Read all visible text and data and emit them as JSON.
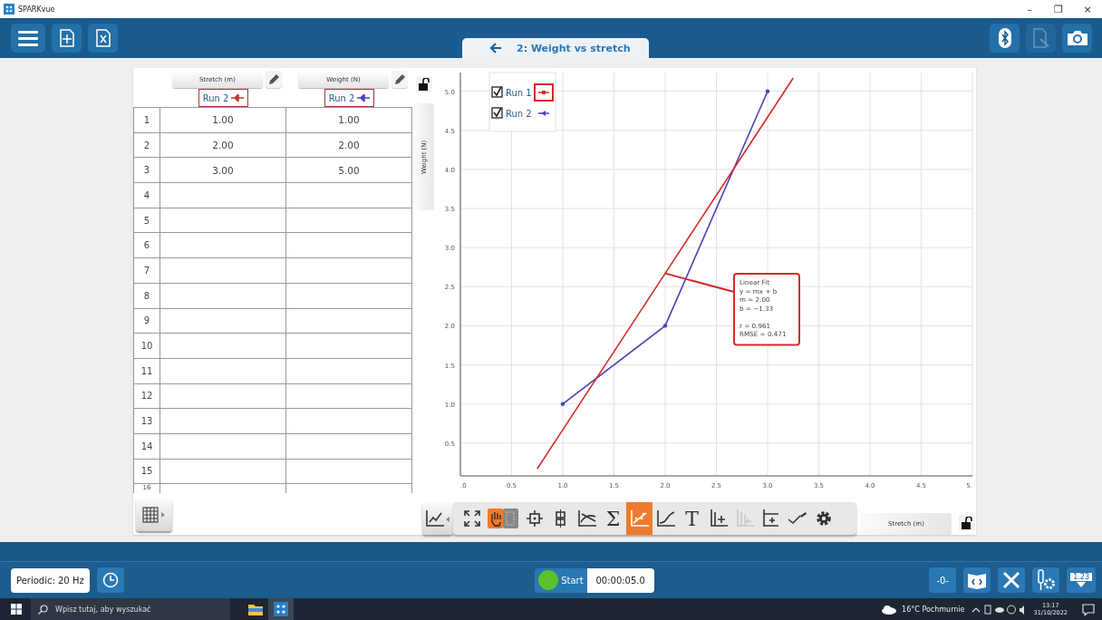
{
  "window": {
    "title": "SPARKvue",
    "controls": [
      "–",
      "❐",
      "×"
    ]
  },
  "header": {
    "left_buttons": [
      {
        "kind": "menu"
      },
      {
        "kind": "new"
      },
      {
        "kind": "close-file"
      }
    ],
    "page_tab": {
      "title": "2: Weight vs stretch"
    },
    "right_buttons": [
      {
        "kind": "bluetooth",
        "disabled": false
      },
      {
        "kind": "export",
        "disabled": true
      },
      {
        "kind": "camera",
        "disabled": false
      }
    ]
  },
  "table": {
    "columns": [
      {
        "title": "Stretch (m)",
        "run": "Run 2",
        "color": "#b83a3a"
      },
      {
        "title": "Weight (N)",
        "run": "Run 2",
        "color": "#4a42b8"
      }
    ],
    "rows": [
      {
        "index": "1",
        "cells": [
          "1.00",
          "1.00"
        ]
      },
      {
        "index": "2",
        "cells": [
          "2.00",
          "2.00"
        ]
      },
      {
        "index": "3",
        "cells": [
          "3.00",
          "5.00"
        ]
      },
      {
        "index": "4"
      },
      {
        "index": "5"
      },
      {
        "index": "6"
      },
      {
        "index": "7"
      },
      {
        "index": "8"
      },
      {
        "index": "9"
      },
      {
        "index": "10"
      },
      {
        "index": "11"
      },
      {
        "index": "12"
      },
      {
        "index": "13"
      },
      {
        "index": "14"
      },
      {
        "index": "15"
      },
      {
        "index": "16"
      }
    ]
  },
  "graph": {
    "y_axis_label": "Weight (N)",
    "x_axis_label": "Stretch (m)",
    "fit_box": {
      "lines": [
        "y = mx + b",
        "m = 2.00",
        "b = −1.33"
      ],
      "stats": [
        "r = 0.961",
        "RMSE = 0.471"
      ]
    },
    "legend": [
      {
        "label": "Run 1",
        "checked": true,
        "color": "#d42a2a",
        "selected": true
      },
      {
        "label": "Run 2",
        "checked": true,
        "color": "#4a42b8",
        "selected": false
      }
    ],
    "chart_data": {
      "type": "line",
      "x": [
        0.75,
        1,
        2,
        3,
        3.25
      ],
      "series": [
        {
          "color": "#4a42b8",
          "values": [
            null,
            1,
            2,
            5,
            null
          ]
        },
        {
          "name": "Linear Fit",
          "color": "#d42a2a",
          "values": [
            0.17,
            0.67,
            2.67,
            4.67,
            5.17
          ]
        }
      ],
      "xlim": [
        0,
        5
      ],
      "ylim": [
        0.08,
        5.24
      ],
      "grid": true,
      "xticks": [
        {
          "value": 0,
          "label": ".0"
        },
        0.5,
        {
          "value": 1,
          "label": "1.0"
        },
        1.5,
        {
          "value": 2,
          "label": "2.0"
        },
        2.5,
        {
          "value": 3,
          "label": "3.0"
        },
        3.5,
        {
          "value": 4,
          "label": "4.0"
        },
        4.5,
        {
          "value": 5,
          "label": "5."
        }
      ],
      "yticks": [
        0.5,
        {
          "value": 1,
          "label": "1.0"
        },
        1.5,
        {
          "value": 2,
          "label": "2.0"
        },
        2.5,
        {
          "value": 3,
          "label": "3.0"
        },
        3.5,
        {
          "value": 4,
          "label": "4.0"
        },
        4.5,
        {
          "value": 5,
          "label": "5.0"
        }
      ]
    },
    "tools": [
      {
        "kind": "fit",
        "selected": false,
        "disabled": false
      },
      {
        "kind": "select",
        "selected": true,
        "disabled": false
      },
      {
        "kind": "coordinates",
        "selected": false,
        "disabled": false
      },
      {
        "kind": "delta",
        "selected": false,
        "disabled": false
      },
      {
        "kind": "tangent",
        "selected": false,
        "disabled": false
      },
      {
        "kind": "sum",
        "label": "Σ",
        "selected": false,
        "disabled": false
      },
      {
        "kind": "linear-fit",
        "selected": true,
        "disabled": false
      },
      {
        "kind": "curve-fit",
        "selected": false,
        "disabled": false
      },
      {
        "kind": "text",
        "label": "T",
        "selected": false,
        "disabled": false
      },
      {
        "kind": "add-y",
        "selected": false,
        "disabled": false
      },
      {
        "kind": "add-plot",
        "selected": false,
        "disabled": true
      },
      {
        "kind": "add-x",
        "selected": false,
        "disabled": false
      },
      {
        "kind": "annotate",
        "selected": false,
        "disabled": false
      },
      {
        "kind": "settings",
        "selected": false,
        "disabled": false
      }
    ]
  },
  "footer": {
    "sampling": "Periodic: 20 Hz",
    "start_label": "Start",
    "timer": "00:00:05.0",
    "zero_label": "-0-",
    "meter_label": "1.23"
  },
  "taskbar": {
    "search_placeholder": "Wpisz tutaj, aby wyszukać",
    "weather": "16°C Pochmurnie",
    "time": "13:17",
    "date": "31/10/2022"
  }
}
